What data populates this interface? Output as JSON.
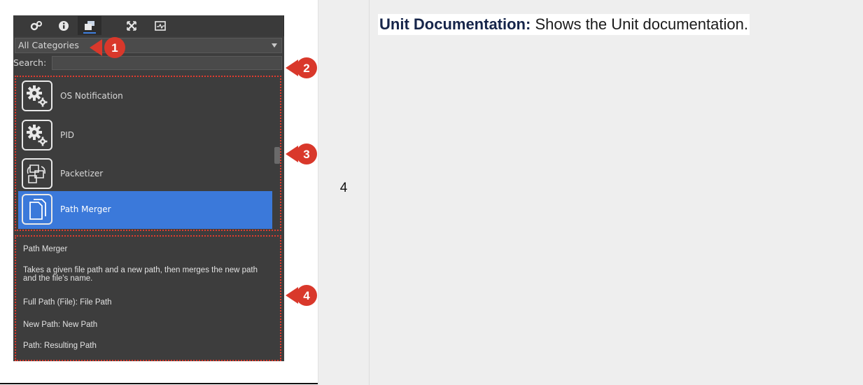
{
  "row_number": "4",
  "description": {
    "term": "Unit Documentation:",
    "text": " Shows the Unit documentation."
  },
  "panel": {
    "toolbar": [
      {
        "name": "gears-icon",
        "glyph": "⚙"
      },
      {
        "name": "info-icon",
        "glyph": "ℹ"
      },
      {
        "name": "units-icon",
        "glyph": "▤"
      },
      {
        "name": "expand-icon",
        "glyph": "✕"
      },
      {
        "name": "monitor-icon",
        "glyph": "⊡"
      }
    ],
    "category_select": "All Categories",
    "search_label": "Search:",
    "search_value": "",
    "units": [
      {
        "label": "OS Notification",
        "icon": "gears-icon",
        "selected": false
      },
      {
        "label": "PID",
        "icon": "gears-icon",
        "selected": false
      },
      {
        "label": "Packetizer",
        "icon": "packetizer-icon",
        "selected": false
      },
      {
        "label": "Path Merger",
        "icon": "documents-icon",
        "selected": true
      }
    ],
    "doc": {
      "title": "Path Merger",
      "summary": "Takes a given file path and a new path, then merges the new path and the file's name.",
      "inputs": [
        "Full Path (File): File Path",
        "New Path: New Path",
        "Path: Resulting Path"
      ]
    }
  },
  "callouts": [
    "1",
    "2",
    "3",
    "4"
  ],
  "colors": {
    "selected": "#3b79da",
    "callout": "#d9382b",
    "panel_bg": "#3d3d3d"
  }
}
